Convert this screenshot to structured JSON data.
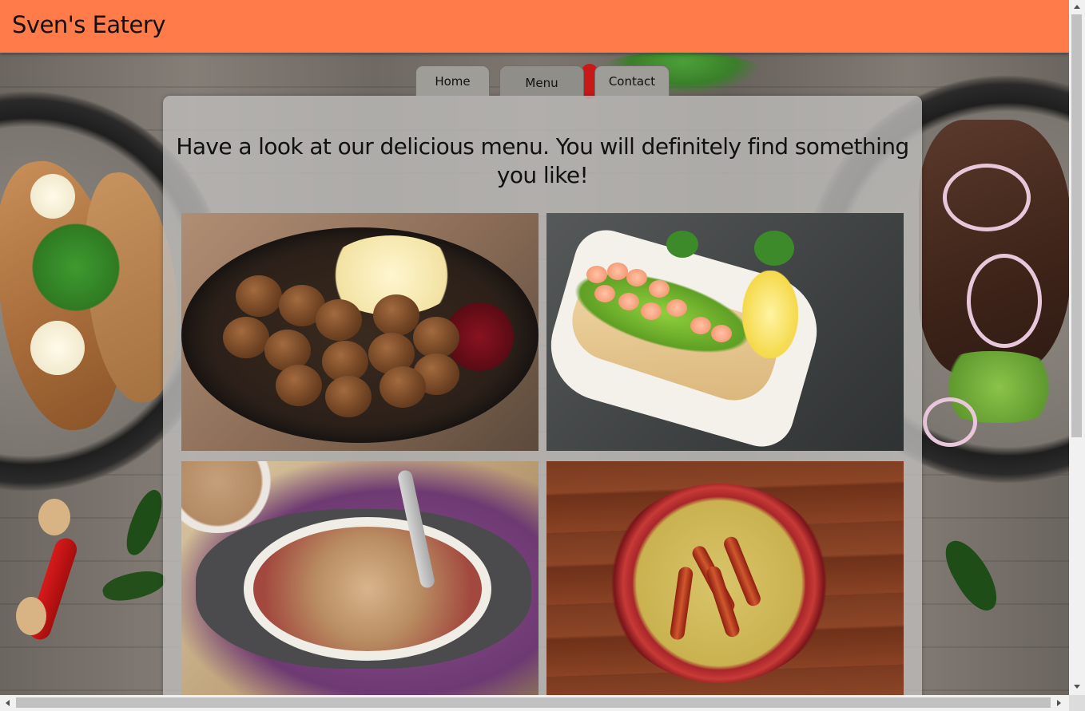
{
  "header": {
    "site_title": "Sven's Eatery"
  },
  "nav": {
    "tabs": [
      {
        "label": "Home"
      },
      {
        "label": "Menu"
      },
      {
        "label": "Contact"
      }
    ],
    "active_tab": "Menu"
  },
  "main": {
    "headline": "Have a look at our delicious menu. You will definitely find something you like!"
  },
  "colors": {
    "header_background": "#ff7b4a",
    "panel_background": "#bebdba",
    "tab_background": "#9e9d98"
  },
  "icons": {
    "scroll_up": "triangle-up-icon",
    "scroll_down": "triangle-down-icon",
    "scroll_left": "triangle-left-icon",
    "scroll_right": "triangle-right-icon"
  }
}
